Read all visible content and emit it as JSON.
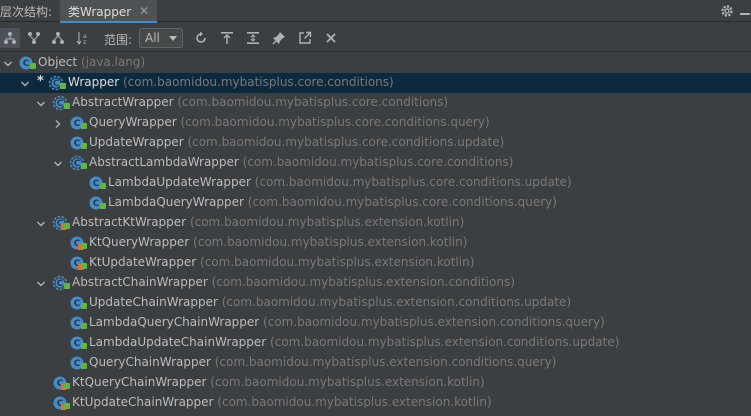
{
  "header": {
    "panel_title": "层次结构:",
    "tab_label": "类Wrapper",
    "close_glyph": "✕"
  },
  "toolbar": {
    "scope_label": "范围:",
    "scope_value": "All",
    "icons": [
      "class-hierarchy-icon",
      "supertypes-icon",
      "subtypes-icon",
      "sort-alpha-icon",
      "refresh-icon",
      "autoscroll-to-source-icon",
      "expand-all-icon",
      "pin-icon",
      "open-in-editor-icon",
      "close-icon"
    ]
  },
  "colors": {
    "selection": "#0d293e",
    "tree_bg": "#3c3f41",
    "class_icon": "#4a8bc2",
    "kotlin_badge": "#e66d2d",
    "lock": "#62b543",
    "package_text": "#787878"
  },
  "tree": [
    {
      "name": "Object",
      "pkg": "(java.lang)",
      "expanded": true,
      "selected": false,
      "kind": "java-class",
      "star": false
    },
    {
      "name": "Wrapper",
      "pkg": "(com.baomidou.mybatisplus.core.conditions)",
      "expanded": true,
      "selected": true,
      "kind": "java-abstract",
      "star": true
    },
    {
      "name": "AbstractWrapper",
      "pkg": "(com.baomidou.mybatisplus.core.conditions)",
      "expanded": true,
      "selected": false,
      "kind": "java-abstract",
      "star": false
    },
    {
      "name": "QueryWrapper",
      "pkg": "(com.baomidou.mybatisplus.core.conditions.query)",
      "expanded": false,
      "selected": false,
      "kind": "java-class",
      "star": false
    },
    {
      "name": "UpdateWrapper",
      "pkg": "(com.baomidou.mybatisplus.core.conditions.update)",
      "expanded": null,
      "selected": false,
      "kind": "java-class",
      "star": false
    },
    {
      "name": "AbstractLambdaWrapper",
      "pkg": "(com.baomidou.mybatisplus.core.conditions)",
      "expanded": true,
      "selected": false,
      "kind": "java-abstract",
      "star": false
    },
    {
      "name": "LambdaUpdateWrapper",
      "pkg": "(com.baomidou.mybatisplus.core.conditions.update)",
      "expanded": null,
      "selected": false,
      "kind": "java-class",
      "star": false
    },
    {
      "name": "LambdaQueryWrapper",
      "pkg": "(com.baomidou.mybatisplus.core.conditions.query)",
      "expanded": null,
      "selected": false,
      "kind": "java-class",
      "star": false
    },
    {
      "name": "AbstractKtWrapper",
      "pkg": "(com.baomidou.mybatisplus.extension.kotlin)",
      "expanded": true,
      "selected": false,
      "kind": "kotlin-abstract",
      "star": false
    },
    {
      "name": "KtQueryWrapper",
      "pkg": "(com.baomidou.mybatisplus.extension.kotlin)",
      "expanded": null,
      "selected": false,
      "kind": "kotlin-class",
      "star": false
    },
    {
      "name": "KtUpdateWrapper",
      "pkg": "(com.baomidou.mybatisplus.extension.kotlin)",
      "expanded": null,
      "selected": false,
      "kind": "kotlin-class",
      "star": false
    },
    {
      "name": "AbstractChainWrapper",
      "pkg": "(com.baomidou.mybatisplus.extension.conditions)",
      "expanded": true,
      "selected": false,
      "kind": "java-abstract",
      "star": false
    },
    {
      "name": "UpdateChainWrapper",
      "pkg": "(com.baomidou.mybatisplus.extension.conditions.update)",
      "expanded": null,
      "selected": false,
      "kind": "java-class",
      "star": false
    },
    {
      "name": "LambdaQueryChainWrapper",
      "pkg": "(com.baomidou.mybatisplus.extension.conditions.query)",
      "expanded": null,
      "selected": false,
      "kind": "java-class",
      "star": false
    },
    {
      "name": "LambdaUpdateChainWrapper",
      "pkg": "(com.baomidou.mybatisplus.extension.conditions.update)",
      "expanded": null,
      "selected": false,
      "kind": "java-class",
      "star": false
    },
    {
      "name": "QueryChainWrapper",
      "pkg": "(com.baomidou.mybatisplus.extension.conditions.query)",
      "expanded": null,
      "selected": false,
      "kind": "java-class",
      "star": false
    },
    {
      "name": "KtQueryChainWrapper",
      "pkg": "(com.baomidou.mybatisplus.extension.kotlin)",
      "expanded": null,
      "selected": false,
      "kind": "kotlin-class",
      "star": false
    },
    {
      "name": "KtUpdateChainWrapper",
      "pkg": "(com.baomidou.mybatisplus.extension.kotlin)",
      "expanded": null,
      "selected": false,
      "kind": "kotlin-class",
      "star": false
    }
  ]
}
